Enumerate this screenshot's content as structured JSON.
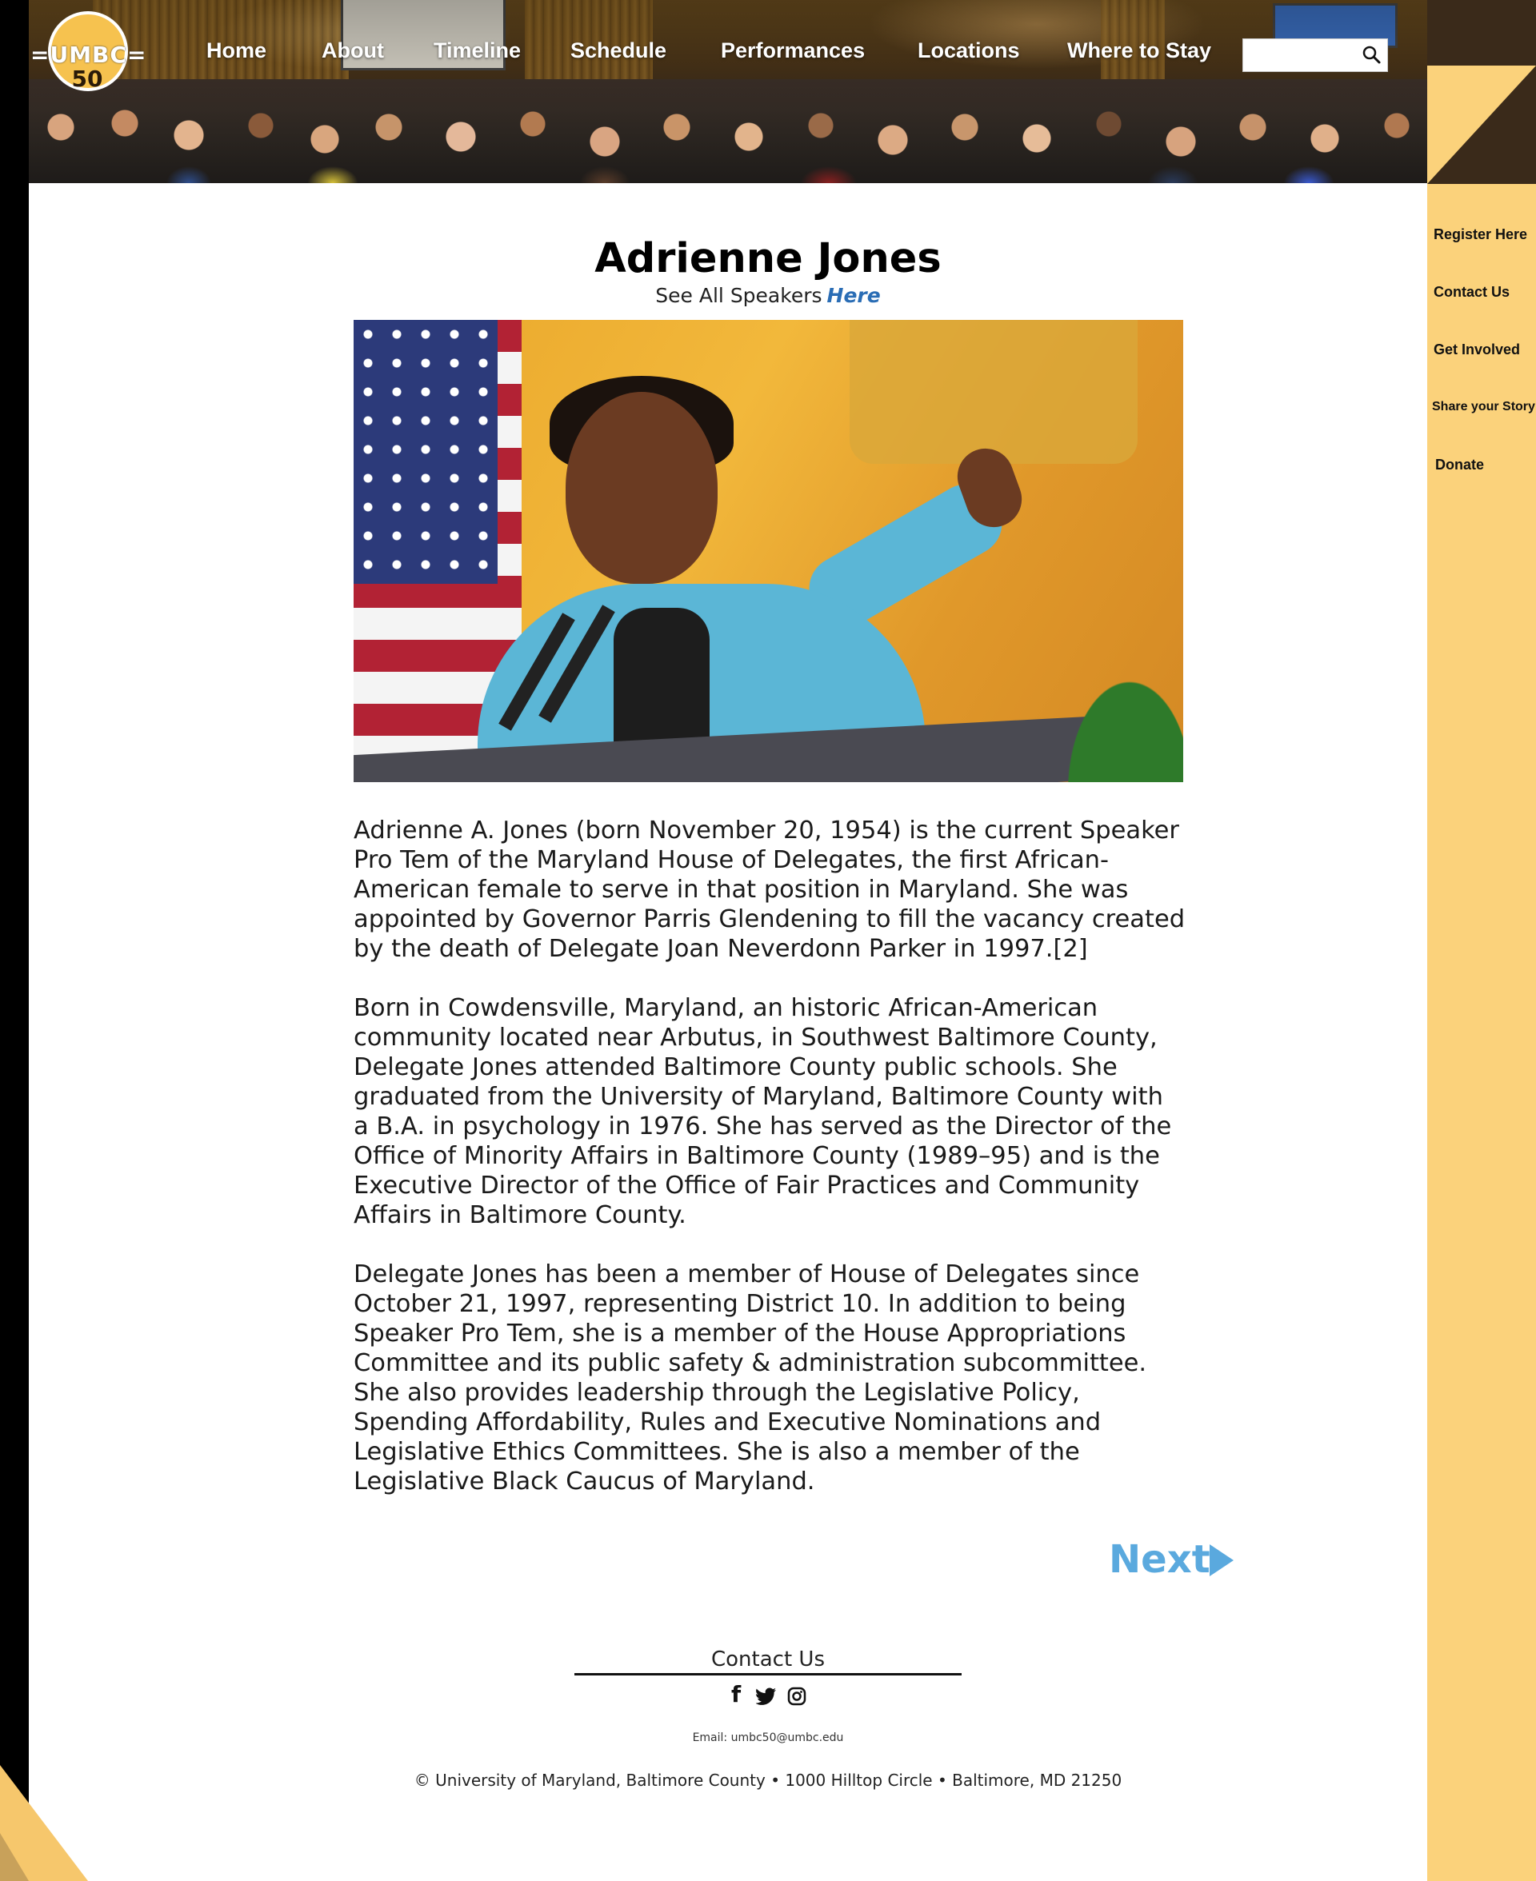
{
  "colors": {
    "sidebar_bg": "#fbd27b",
    "sidebar_dark": "#3a2a1a",
    "link_blue": "#2a6db5",
    "next_blue": "#5aa9de",
    "logo_gold": "#f6c24f"
  },
  "logo": {
    "text": "=UMBC=",
    "number": "50"
  },
  "nav": {
    "items": [
      "Home",
      "About",
      "Timeline",
      "Schedule",
      "Performances",
      "Locations",
      "Where to Stay"
    ],
    "search_placeholder": "",
    "search_icon": "search-icon"
  },
  "sidebar": {
    "items": [
      "Register Here",
      "Contact Us",
      "Get Involved",
      "Share your Story",
      "Donate"
    ]
  },
  "page": {
    "title": "Adrienne Jones",
    "see_all_text": "See All Speakers",
    "see_all_link": "Here"
  },
  "bio": {
    "paragraphs": [
      "Adrienne A. Jones (born November 20, 1954) is the current Speaker Pro Tem of the Maryland House of Delegates, the first African-American female to serve in that position in Maryland. She was appointed by Governor Parris Glendening to fill the vacancy created by the death of Delegate Joan Neverdonn Parker in 1997.[2]",
      "Born in Cowdensville, Maryland, an historic African-American community located near Arbutus, in Southwest Baltimore County, Delegate Jones attended Baltimore County public schools. She graduated from the University of Maryland, Baltimore County with a B.A. in psychology in 1976. She has served as the Director of the Office of Minority Affairs in Baltimore County (1989–95) and is the Executive Director of the Office of Fair Practices and Community Affairs in Baltimore County.",
      "Delegate Jones has been a member of House of Delegates since October 21, 1997, representing District 10. In addition to being Speaker Pro Tem, she is a member of the House Appropriations Committee and its public safety & administration subcommittee. She also provides leadership through the Legislative Policy, Spending Affordability, Rules and Executive Nominations and Legislative Ethics Committees. She is also a member of the Legislative Black Caucus of Maryland."
    ]
  },
  "pager": {
    "next_label": "Next"
  },
  "footer": {
    "contact_label": "Contact Us",
    "social": [
      "facebook-icon",
      "twitter-icon",
      "instagram-icon"
    ],
    "facebook_glyph": "f",
    "email": "Email: umbc50@umbc.edu",
    "address": "© University of Maryland, Baltimore County • 1000 Hilltop Circle • Baltimore, MD 21250"
  }
}
